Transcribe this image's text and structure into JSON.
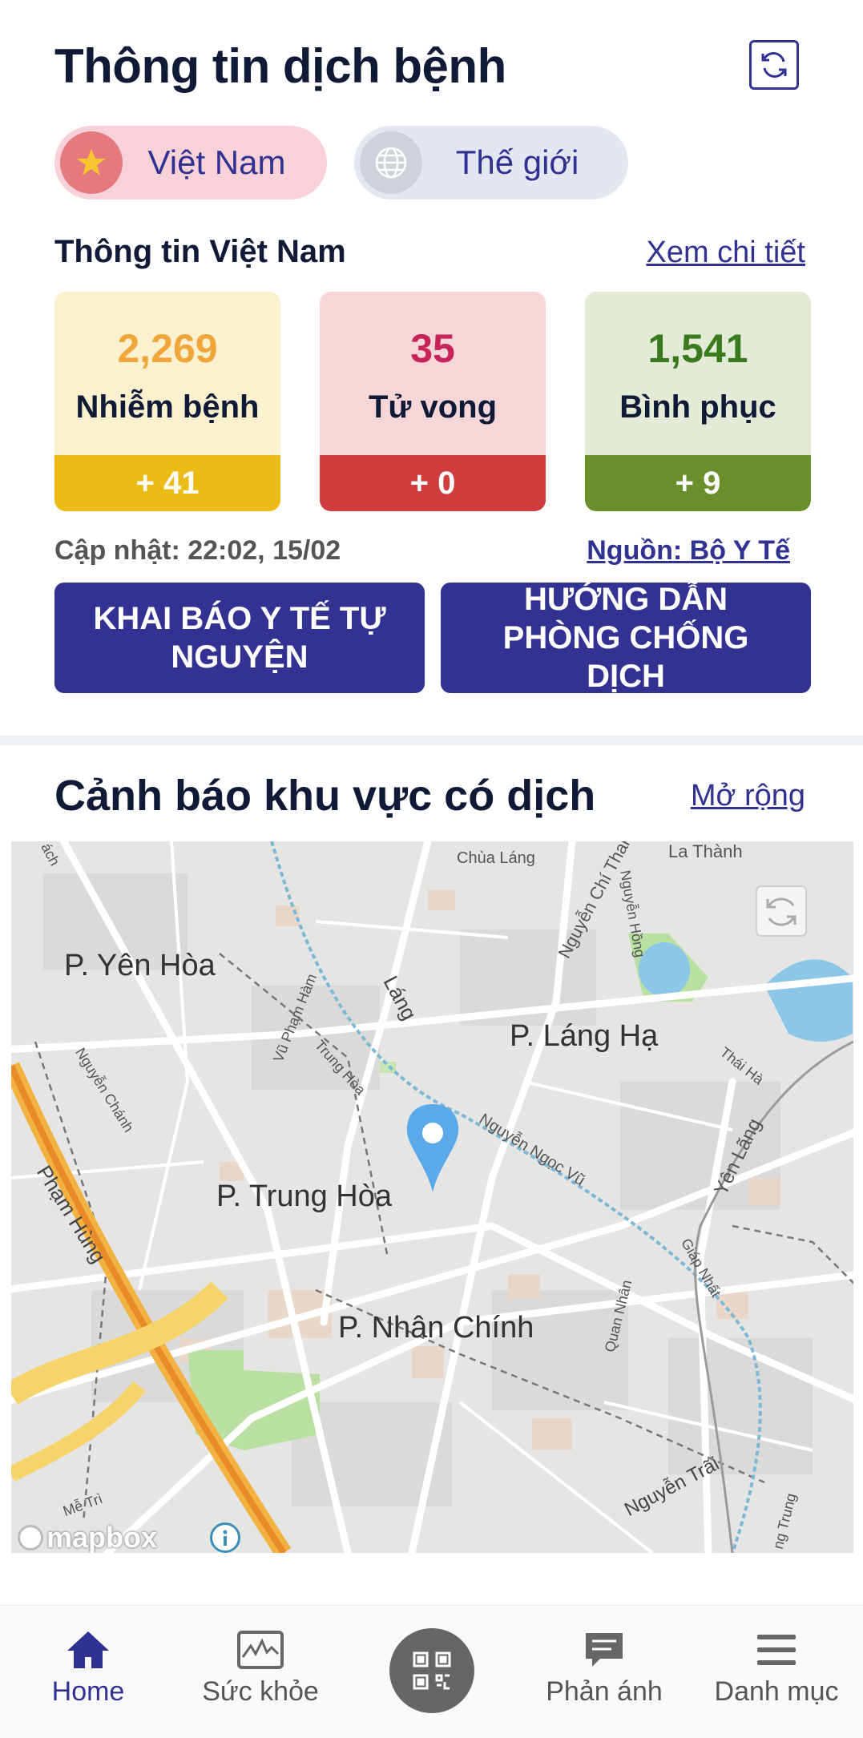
{
  "header": {
    "title": "Thông tin dịch bệnh"
  },
  "tabs": [
    {
      "label": "Việt Nam",
      "icon": "star-icon",
      "active": true
    },
    {
      "label": "Thế giới",
      "icon": "globe-icon",
      "active": false
    }
  ],
  "vn_info": {
    "title": "Thông tin Việt Nam",
    "detail_link": "Xem chi tiết",
    "stats": [
      {
        "value": "2,269",
        "label": "Nhiễm bệnh",
        "delta": "+ 41",
        "color": "#f0a63a",
        "bg": "#fbf1cf",
        "delta_bg": "#ecbb16"
      },
      {
        "value": "35",
        "label": "Tử vong",
        "delta": "+ 0",
        "color": "#c8245a",
        "bg": "#f7d6d8",
        "delta_bg": "#cf3d3e"
      },
      {
        "value": "1,541",
        "label": "Bình phục",
        "delta": "+ 9",
        "color": "#3a7a1f",
        "bg": "#e3ead6",
        "delta_bg": "#6a8f2c"
      }
    ],
    "updated": "Cập nhật: 22:02, 15/02",
    "source": "Nguồn: Bộ Y Tế"
  },
  "actions": {
    "declare": "KHAI BÁO Y TẾ TỰ NGUYỆN",
    "guide": "HƯỚNG DẪN PHÒNG CHỐNG DỊCH"
  },
  "alerts": {
    "title": "Cảnh báo khu vực có dịch",
    "expand": "Mở rộng"
  },
  "map": {
    "districts": [
      "P. Yên Hòa",
      "P. Láng Hạ",
      "P. Trung Hòa",
      "P. Nhân Chính"
    ],
    "streets": [
      "Chùa Láng",
      "Nguyễn Chí Thanh",
      "Nguyễn Hồng",
      "Láng",
      "Vũ Phạm Hàm",
      "Trung Hòa",
      "Nguyễn Ngọc Vũ",
      "Thái Hà",
      "Yên Lãng",
      "Nguyễn Chánh",
      "Phạm Hùng",
      "Quan Nhân",
      "Giáp Nhất",
      "Nguyễn Trãi",
      "Mễ Trì",
      "ách",
      "La Thành",
      "ng Trung"
    ],
    "attribution": "mapbox"
  },
  "nav": [
    {
      "label": "Home",
      "icon": "home-icon",
      "active": true
    },
    {
      "label": "Sức khỏe",
      "icon": "health-icon",
      "active": false
    },
    {
      "label": "",
      "icon": "qr-code-icon",
      "active": false
    },
    {
      "label": "Phản ánh",
      "icon": "feedback-icon",
      "active": false
    },
    {
      "label": "Danh mục",
      "icon": "menu-icon",
      "active": false
    }
  ],
  "colors": {
    "primary": "#323292",
    "text": "#0f1a36"
  }
}
